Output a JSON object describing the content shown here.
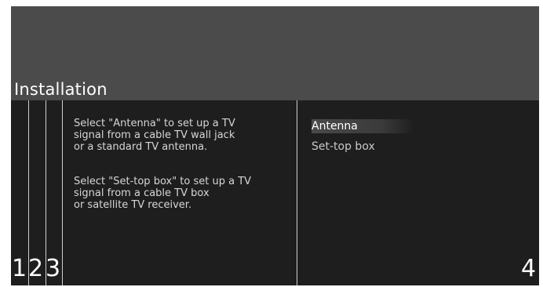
{
  "header": {
    "title": "Installation"
  },
  "description": {
    "antenna_text": "Select \"Antenna\" to set up a TV\nsignal from a cable TV wall jack\nor a standard TV antenna.",
    "settop_text": "Select \"Set-top box\" to set up a TV\nsignal from a cable TV box\nor satellite TV receiver."
  },
  "menu": {
    "items": [
      {
        "label": "Antenna",
        "selected": true
      },
      {
        "label": "Set-top box",
        "selected": false
      }
    ]
  },
  "steps": {
    "left": [
      "1",
      "2",
      "3"
    ],
    "right": "4"
  },
  "colors": {
    "background": "#1e1e1e",
    "header": "#4b4b4b",
    "text": "#ffffff"
  }
}
